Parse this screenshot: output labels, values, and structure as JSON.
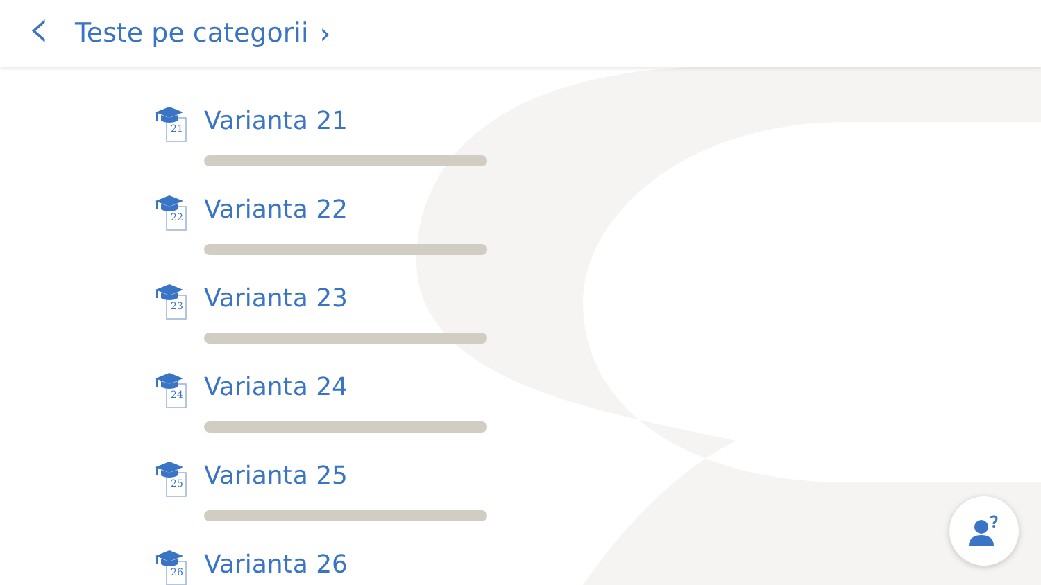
{
  "header": {
    "back": "‹",
    "title": "Teste pe categorii",
    "chevron": "›"
  },
  "tests": [
    {
      "number": "21",
      "label": "Varianta 21",
      "level": 0
    },
    {
      "number": "22",
      "label": "Varianta 22",
      "level": 0
    },
    {
      "number": "23",
      "label": "Varianta 23",
      "level": 0
    },
    {
      "number": "24",
      "label": "Varianta 24",
      "level": 0
    },
    {
      "number": "25",
      "label": "Varianta 25",
      "level": 0
    },
    {
      "number": "26",
      "label": "Varianta 26"
    }
  ]
}
